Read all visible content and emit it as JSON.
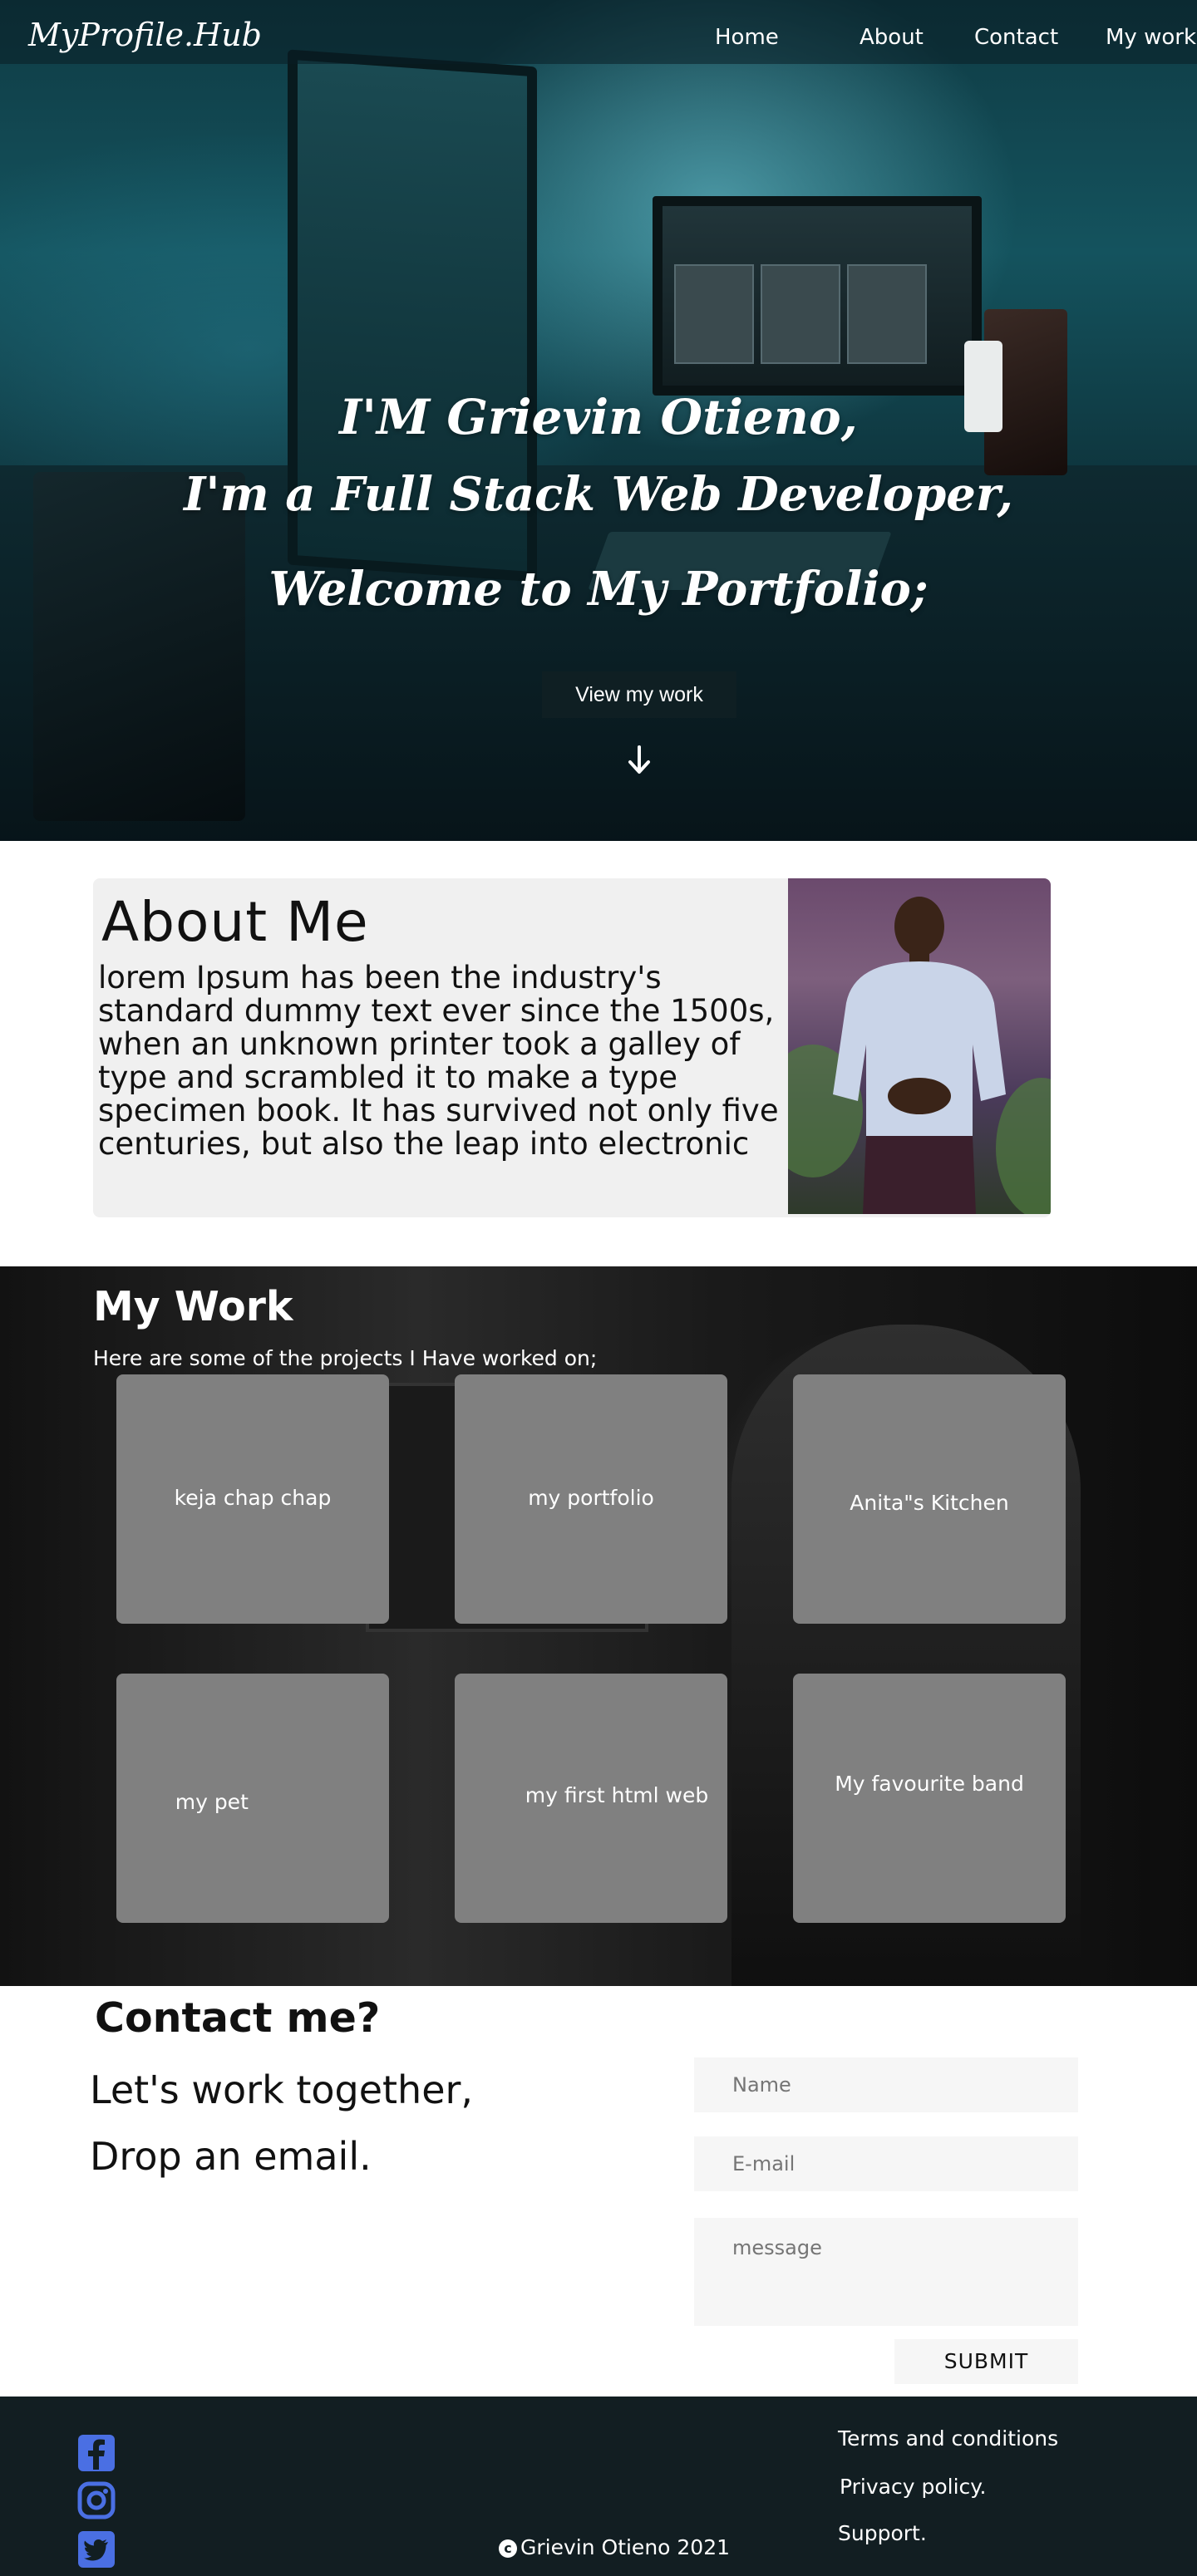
{
  "nav": {
    "logo": "MyProfile.Hub",
    "links": [
      "Home",
      "About",
      "Contact",
      "My work"
    ]
  },
  "hero": {
    "line1": "I'M Grievin Otieno,",
    "line2": "I'm a Full Stack Web Developer,",
    "line3": "Welcome to My Portfolio;",
    "button": "View my work",
    "arrow_icon": "arrow-down-icon"
  },
  "about": {
    "title": "About Me",
    "text": "lorem Ipsum has been the industry's standard dummy text ever since the 1500s, when an unknown printer took a galley of type and scrambled it to make a type specimen book. It has survived not only five centuries, but also the leap into electronic"
  },
  "work": {
    "title": "My Work",
    "subtitle": "Here are some of  the projects I Have worked on;",
    "projects": [
      "keja chap chap",
      "my portfolio",
      "Anita\"s Kitchen",
      "my pet",
      "my first html web",
      "My favourite band"
    ]
  },
  "contact": {
    "title": "Contact me?",
    "line1": "Let's work together,",
    "line2": "Drop an email.",
    "name_placeholder": "Name",
    "email_placeholder": "E-mail",
    "message_placeholder": "message",
    "submit": "SUBMIT"
  },
  "footer": {
    "links": [
      "Terms and conditions",
      "Privacy policy.",
      "Support."
    ],
    "copyright": "Grievin Otieno 2021",
    "social_icons": [
      "facebook-icon",
      "instagram-icon",
      "twitter-icon"
    ],
    "icon_color": "#4a6fe3"
  }
}
